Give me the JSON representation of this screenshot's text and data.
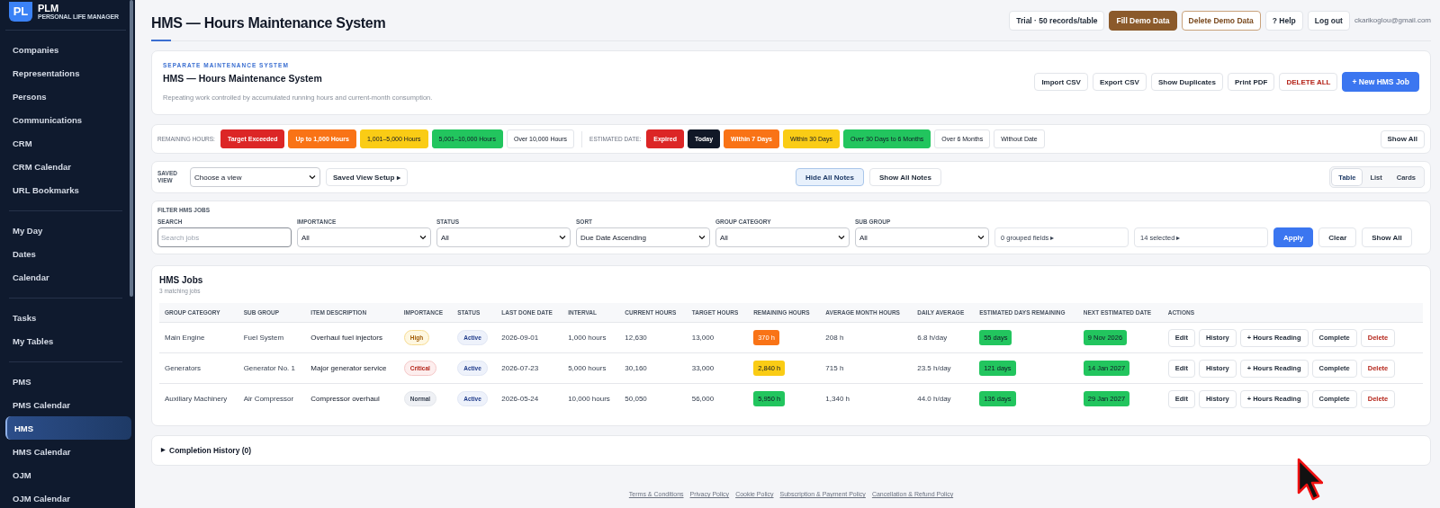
{
  "sidebar": {
    "logo": {
      "mark": "PL",
      "name": "PLM",
      "tagline": "PERSONAL LIFE MANAGER"
    },
    "groups": [
      [
        {
          "label": "Companies",
          "selected": false
        },
        {
          "label": "Representations",
          "selected": false
        },
        {
          "label": "Persons",
          "selected": false
        },
        {
          "label": "Communications",
          "selected": false
        },
        {
          "label": "CRM",
          "selected": false
        },
        {
          "label": "CRM Calendar",
          "selected": false
        },
        {
          "label": "URL Bookmarks",
          "selected": false
        }
      ],
      [
        {
          "label": "My Day",
          "selected": false
        },
        {
          "label": "Dates",
          "selected": false
        },
        {
          "label": "Calendar",
          "selected": false
        }
      ],
      [
        {
          "label": "Tasks",
          "selected": false
        },
        {
          "label": "My Tables",
          "selected": false
        }
      ],
      [
        {
          "label": "PMS",
          "selected": false
        },
        {
          "label": "PMS Calendar",
          "selected": false
        },
        {
          "label": "HMS",
          "selected": true
        },
        {
          "label": "HMS Calendar",
          "selected": false
        },
        {
          "label": "OJM",
          "selected": false
        },
        {
          "label": "OJM Calendar",
          "selected": false
        }
      ]
    ]
  },
  "header": {
    "title": "HMS — Hours Maintenance System",
    "actions": [
      {
        "label": "Trial · 50 records/table",
        "kind": "plain"
      },
      {
        "label": "Fill Demo Data",
        "kind": "filled"
      },
      {
        "label": "Delete Demo Data",
        "kind": "outline"
      },
      {
        "label": "? Help",
        "kind": "plain"
      },
      {
        "label": "Log out",
        "kind": "plain"
      }
    ],
    "email": "ckarikoglou@gmail.com"
  },
  "intro": {
    "eyebrow": "SEPARATE MAINTENANCE SYSTEM",
    "title": "HMS — Hours Maintenance System",
    "description": "Repeating work controlled by accumulated running hours and current-month consumption.",
    "actions": [
      {
        "label": "Import CSV",
        "kind": "plain"
      },
      {
        "label": "Export CSV",
        "kind": "plain"
      },
      {
        "label": "Show Duplicates",
        "kind": "plain"
      },
      {
        "label": "Print PDF",
        "kind": "plain"
      },
      {
        "label": "DELETE ALL",
        "kind": "danger"
      },
      {
        "label": "+ New HMS Job",
        "kind": "primary"
      }
    ]
  },
  "legend": {
    "remaining_label": "REMAINING HOURS:",
    "remaining": [
      {
        "label": "Target Exceeded",
        "color": "#dc2626"
      },
      {
        "label": "Up to 1,000 Hours",
        "color": "#f97316"
      },
      {
        "label": "1,001–5,000 Hours",
        "color": "#facc15"
      },
      {
        "label": "5,001–10,000 Hours",
        "color": "#22c55e"
      },
      {
        "label": "Over 10,000 Hours",
        "color": "#ffffff"
      }
    ],
    "estimated_label": "ESTIMATED DATE:",
    "estimated": [
      {
        "label": "Expired",
        "color": "#dc2626"
      },
      {
        "label": "Today",
        "color": "#111827"
      },
      {
        "label": "Within 7 Days",
        "color": "#f97316"
      },
      {
        "label": "Within 30 Days",
        "color": "#facc15"
      },
      {
        "label": "Over 30 Days to 6 Months",
        "color": "#22c55e"
      },
      {
        "label": "Over 6 Months",
        "color": "#ffffff"
      },
      {
        "label": "Without Date",
        "color": "#ffffff"
      }
    ],
    "show_all": "Show All"
  },
  "view_bar": {
    "label": "SAVED VIEW",
    "select": "Choose a view",
    "setup": "Saved View Setup ▸",
    "notes": [
      {
        "label": "Hide All Notes",
        "selected": true
      },
      {
        "label": "Show All Notes",
        "selected": false
      }
    ],
    "modes": [
      {
        "label": "Table",
        "selected": true
      },
      {
        "label": "List",
        "selected": false
      },
      {
        "label": "Cards",
        "selected": false
      }
    ]
  },
  "filter": {
    "title": "FILTER HMS JOBS",
    "fields": [
      {
        "label": "SEARCH",
        "kind": "input",
        "placeholder": "Search jobs"
      },
      {
        "label": "IMPORTANCE",
        "kind": "select",
        "value": "All"
      },
      {
        "label": "STATUS",
        "kind": "select",
        "value": "All"
      },
      {
        "label": "SORT",
        "kind": "select",
        "value": "Due Date Ascending"
      },
      {
        "label": "GROUP CATEGORY",
        "kind": "select",
        "value": "All"
      },
      {
        "label": "SUB GROUP",
        "kind": "select",
        "value": "All"
      },
      {
        "kind": "menu",
        "value": "0 grouped fields ▸"
      },
      {
        "kind": "menu",
        "value": "14 selected ▸"
      }
    ],
    "buttons": [
      {
        "label": "Apply",
        "kind": "primary"
      },
      {
        "label": "Clear",
        "kind": "plain"
      },
      {
        "label": "Show All",
        "kind": "plain"
      }
    ]
  },
  "jobs": {
    "title": "HMS Jobs",
    "subtitle": "3 matching jobs",
    "columns": [
      "GROUP CATEGORY",
      "SUB GROUP",
      "ITEM DESCRIPTION",
      "IMPORTANCE",
      "STATUS",
      "LAST DONE DATE",
      "INTERVAL",
      "CURRENT HOURS",
      "TARGET HOURS",
      "REMAINING HOURS",
      "AVERAGE MONTH HOURS",
      "DAILY AVERAGE",
      "ESTIMATED DAYS REMAINING",
      "NEXT ESTIMATED DATE",
      "ACTIONS"
    ],
    "rows": [
      {
        "group": "Main Engine",
        "sub_group": "Fuel System",
        "item": "Overhaul fuel injectors",
        "importance": {
          "label": "High",
          "kind": "high"
        },
        "status": "Active",
        "last_done": "2026-09-01",
        "interval": "1,000 hours",
        "current": "12,630",
        "target": "13,000",
        "remaining": {
          "label": "370 h",
          "color": "#f97316"
        },
        "avg_month": "208 h",
        "daily": "6.8 h/day",
        "days": {
          "label": "55 days",
          "color": "#22c55e"
        },
        "next": {
          "label": "9 Nov 2026",
          "color": "#22c55e"
        },
        "actions": [
          {
            "label": "Edit",
            "kind": "plain"
          },
          {
            "label": "History",
            "kind": "plain"
          },
          {
            "label": "+ Hours Reading",
            "kind": "plain"
          },
          {
            "label": "Complete",
            "kind": "plain"
          },
          {
            "label": "Delete",
            "kind": "danger"
          }
        ]
      },
      {
        "group": "Generators",
        "sub_group": "Generator No. 1",
        "item": "Major generator service",
        "importance": {
          "label": "Critical",
          "kind": "critical"
        },
        "status": "Active",
        "last_done": "2026-07-23",
        "interval": "5,000 hours",
        "current": "30,160",
        "target": "33,000",
        "remaining": {
          "label": "2,840 h",
          "color": "#facc15"
        },
        "avg_month": "715 h",
        "daily": "23.5 h/day",
        "days": {
          "label": "121 days",
          "color": "#22c55e"
        },
        "next": {
          "label": "14 Jan 2027",
          "color": "#22c55e"
        },
        "actions": [
          {
            "label": "Edit",
            "kind": "plain"
          },
          {
            "label": "History",
            "kind": "plain"
          },
          {
            "label": "+ Hours Reading",
            "kind": "plain"
          },
          {
            "label": "Complete",
            "kind": "plain"
          },
          {
            "label": "Delete",
            "kind": "danger"
          }
        ]
      },
      {
        "group": "Auxiliary Machinery",
        "sub_group": "Air Compressor",
        "item": "Compressor overhaul",
        "importance": {
          "label": "Normal",
          "kind": "normal"
        },
        "status": "Active",
        "last_done": "2026-05-24",
        "interval": "10,000 hours",
        "current": "50,050",
        "target": "56,000",
        "remaining": {
          "label": "5,950 h",
          "color": "#22c55e"
        },
        "avg_month": "1,340 h",
        "daily": "44.0 h/day",
        "days": {
          "label": "136 days",
          "color": "#22c55e"
        },
        "next": {
          "label": "29 Jan 2027",
          "color": "#22c55e"
        },
        "actions": [
          {
            "label": "Edit",
            "kind": "plain"
          },
          {
            "label": "History",
            "kind": "plain"
          },
          {
            "label": "+ Hours Reading",
            "kind": "plain"
          },
          {
            "label": "Complete",
            "kind": "plain"
          },
          {
            "label": "Delete",
            "kind": "danger"
          }
        ]
      }
    ]
  },
  "history": {
    "marker": "▶",
    "label": "Completion History (0)",
    "expanded": false
  },
  "footer": [
    "Terms & Conditions",
    "Privacy Policy",
    "Cookie Policy",
    "Subscription & Payment Policy",
    "Cancellation & Refund Policy"
  ]
}
